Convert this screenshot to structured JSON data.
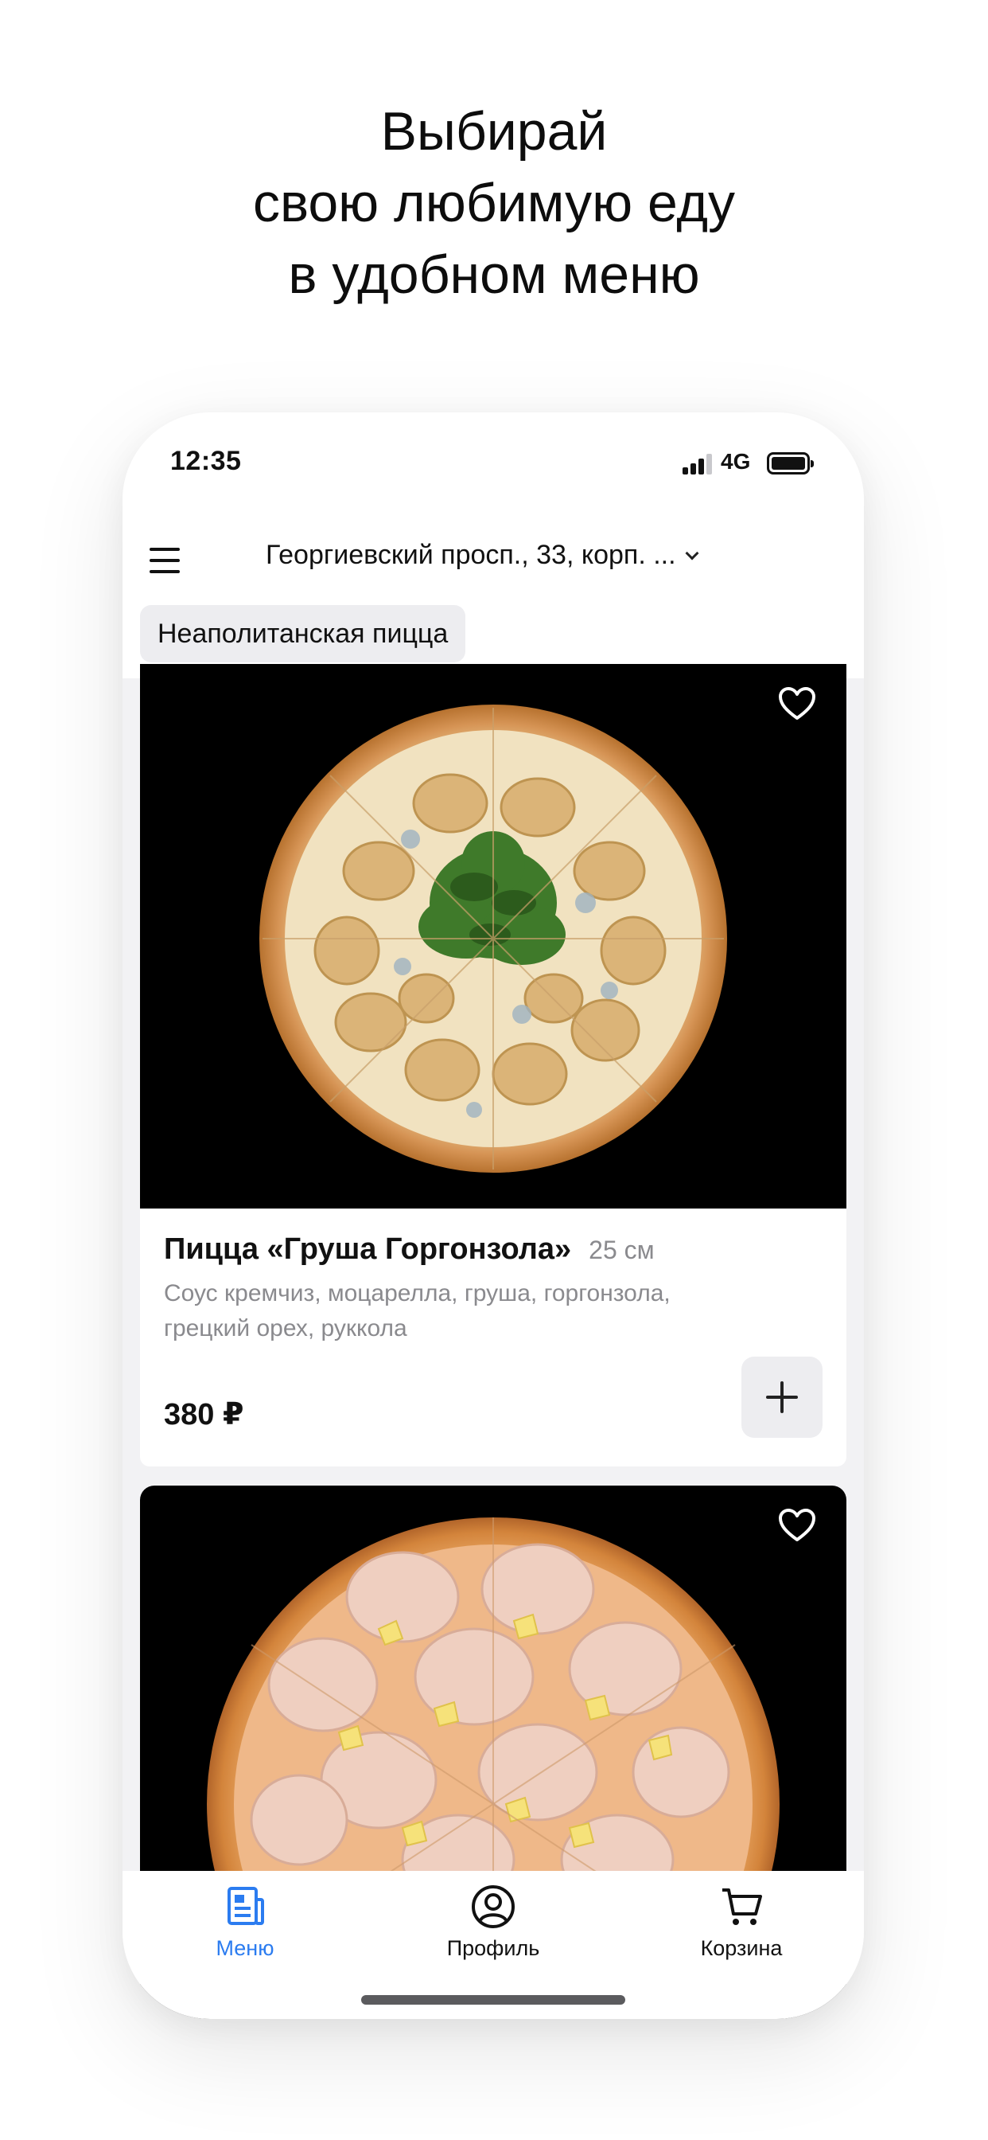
{
  "promo": {
    "line1": "Выбирай",
    "line2": "свою любимую еду",
    "line3": "в удобном меню"
  },
  "status": {
    "time": "12:35",
    "network": "4G"
  },
  "header": {
    "address": "Георгиевский просп., 33, корп. ..."
  },
  "category_chip": "Неаполитанская пицца",
  "products": [
    {
      "name": "Пицца «Груша Горгонзола»",
      "size": "25 см",
      "description": "Соус кремчиз, моцарелла, груша, горгонзола, грецкий орех, руккола",
      "price": "380 ₽"
    },
    {
      "name": "",
      "size": "",
      "description": "",
      "price": ""
    }
  ],
  "nav": {
    "menu": "Меню",
    "profile": "Профиль",
    "cart": "Корзина"
  },
  "colors": {
    "accent": "#2B7CF0",
    "chip_bg": "#EDEDF0",
    "muted_text": "#8A8A8E"
  }
}
